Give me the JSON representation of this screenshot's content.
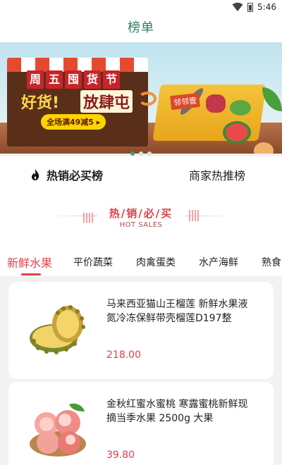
{
  "status_bar": {
    "time": "5:46"
  },
  "header": {
    "title": "榜单"
  },
  "banner": {
    "title_chars": [
      "周",
      "五",
      "囤",
      "货",
      "节"
    ],
    "slogan_left": "好货!",
    "slogan_right": "放肆屯",
    "pill": "全场满49减5",
    "basket_label": "邻邻壹",
    "page_count": 3,
    "active_page": 0
  },
  "rank_tabs": [
    {
      "label": "热销必买榜",
      "active": true,
      "icon": "fire-icon"
    },
    {
      "label": "商家热推榜",
      "active": false
    }
  ],
  "hot_header": {
    "title": "热/销/必/买",
    "subtitle": "HOT SALES"
  },
  "categories": [
    {
      "label": "新鲜水果",
      "active": true
    },
    {
      "label": "平价蔬菜",
      "active": false
    },
    {
      "label": "肉禽蛋类",
      "active": false
    },
    {
      "label": "水产海鲜",
      "active": false
    },
    {
      "label": "熟食",
      "active": false
    }
  ],
  "products": [
    {
      "name": "马来西亚猫山王榴莲 新鲜水果液氮冷冻保鲜带壳榴莲D197整",
      "price": "218.00",
      "image": "durian"
    },
    {
      "name": "金秋红蜜水蜜桃 寒露蜜桃新鲜现摘当季水果 2500g 大果",
      "price": "39.80",
      "image": "peach"
    }
  ],
  "colors": {
    "accent": "#e0434a",
    "title_green": "#2e7d5b"
  }
}
